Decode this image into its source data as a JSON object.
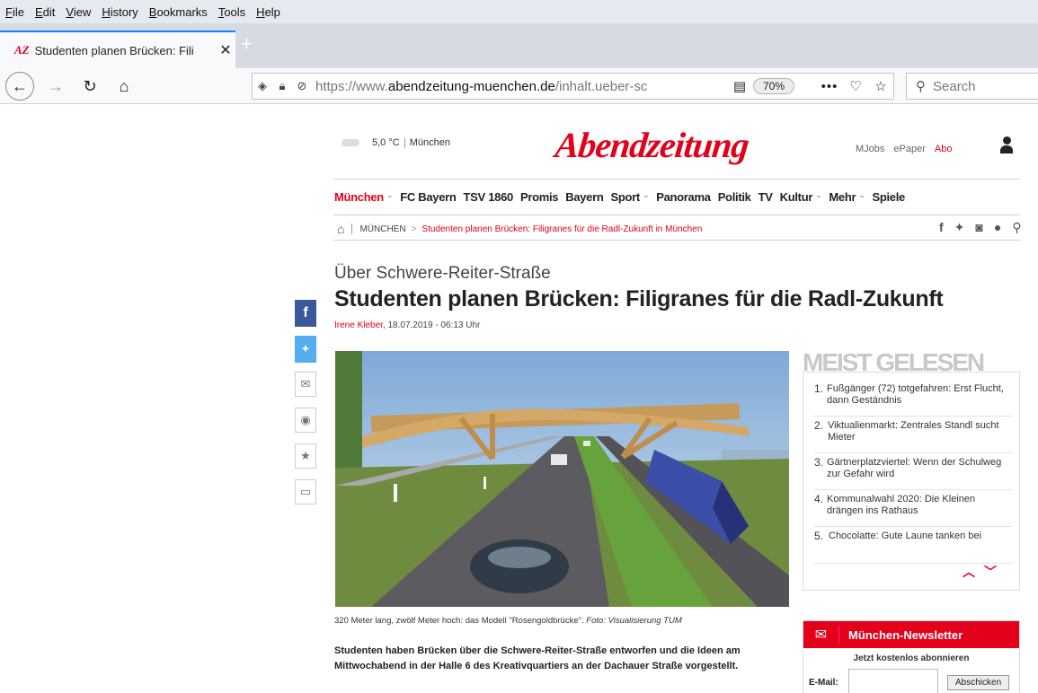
{
  "browser": {
    "menu": [
      "File",
      "Edit",
      "View",
      "History",
      "Bookmarks",
      "Tools",
      "Help"
    ],
    "tab_title": "Studenten planen Brücken: Fili",
    "tab_favicon": "AZ",
    "tab_close": "✕",
    "new_tab": "+",
    "url_prefix": "https://www.",
    "url_domain": "abendzeitung-muenchen.de",
    "url_path": "/inhalt.ueber-sc",
    "zoom": "70%",
    "more": "•••",
    "search_placeholder": "Search"
  },
  "header": {
    "temperature": "5,0 °C",
    "city": "München",
    "logo": "Abendzeitung",
    "links": [
      "MJobs",
      "ePaper"
    ],
    "abo": "Abo"
  },
  "nav": {
    "items": [
      {
        "label": "München",
        "chevron": true,
        "active": true
      },
      {
        "label": "FC Bayern"
      },
      {
        "label": "TSV 1860"
      },
      {
        "label": "Promis"
      },
      {
        "label": "Bayern"
      },
      {
        "label": "Sport",
        "chevron": true
      },
      {
        "label": "Panorama"
      },
      {
        "label": "Politik"
      },
      {
        "label": "TV"
      },
      {
        "label": "Kultur",
        "chevron": true
      },
      {
        "label": "Mehr",
        "chevron": true
      },
      {
        "label": "Spiele"
      }
    ]
  },
  "breadcrumb": {
    "section": "MÜNCHEN",
    "current": "Studenten planen Brücken: Filigranes für die Radl-Zukunft in München"
  },
  "article": {
    "kicker": "Über Schwere-Reiter-Straße",
    "headline": "Studenten planen Brücken: Filigranes für die Radl-Zukunft",
    "author": "Irene Kleber",
    "date": ", 18.07.2019 - 06:13 Uhr",
    "caption": "320 Meter lang, zwölf Meter hoch: das Modell \"Rosengoldbrücke\".",
    "caption_credit": "Foto: Visualisierung TUM",
    "lead": "Studenten haben Brücken über die Schwere-Reiter-Straße entworfen und die Ideen am Mittwochabend in der Halle 6 des Kreativquartiers an der Dachauer Straße vorgestellt."
  },
  "most_read": {
    "title": "MEIST GELESEN",
    "items": [
      {
        "num": "1.",
        "text": "Fußgänger (72) totgefahren: Erst Flucht, dann Geständnis"
      },
      {
        "num": "2.",
        "text": "Viktualienmarkt: Zentrales Standl sucht Mieter"
      },
      {
        "num": "3.",
        "text": "Gärtnerplatzviertel: Wenn der Schulweg zur Gefahr wird"
      },
      {
        "num": "4.",
        "text": "Kommunalwahl 2020: Die Kleinen drängen ins Rathaus"
      },
      {
        "num": "5.",
        "text": "Chocolatte: Gute Laune tanken bei"
      }
    ]
  },
  "newsletter": {
    "title": "München-Newsletter",
    "subtitle": "Jetzt kostenlos abonnieren",
    "email_label": "E-Mail:",
    "submit": "Abschicken"
  },
  "colors": {
    "brand_red": "#e2001a",
    "facebook": "#3b5998",
    "twitter": "#55acee"
  }
}
